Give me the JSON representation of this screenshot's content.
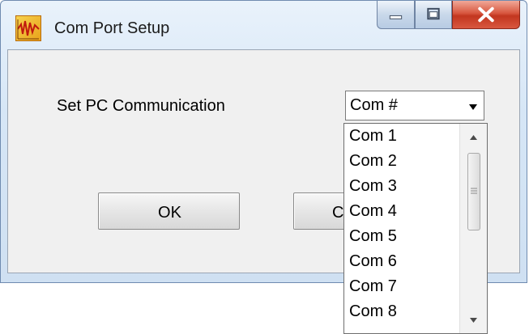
{
  "window": {
    "title": "Com Port Setup",
    "icon": "seismograph-app-icon",
    "controls": {
      "minimize": "minimize-icon",
      "maximize": "maximize-icon",
      "close": "close-icon"
    }
  },
  "form": {
    "label": "Set PC Communication",
    "combo": {
      "selected": "Com #",
      "arrow_icon": "chevron-down-icon"
    },
    "ok_label": "OK",
    "cancel_label": "C"
  },
  "dropdown": {
    "items": [
      "Com 1",
      "Com 2",
      "Com 3",
      "Com 4",
      "Com 5",
      "Com 6",
      "Com 7",
      "Com 8"
    ],
    "scroll_fraction": 0.0
  },
  "colors": {
    "titlebar": "#d6e6f6",
    "close_button": "#c2361f",
    "client_bg": "#f0f0f0"
  }
}
